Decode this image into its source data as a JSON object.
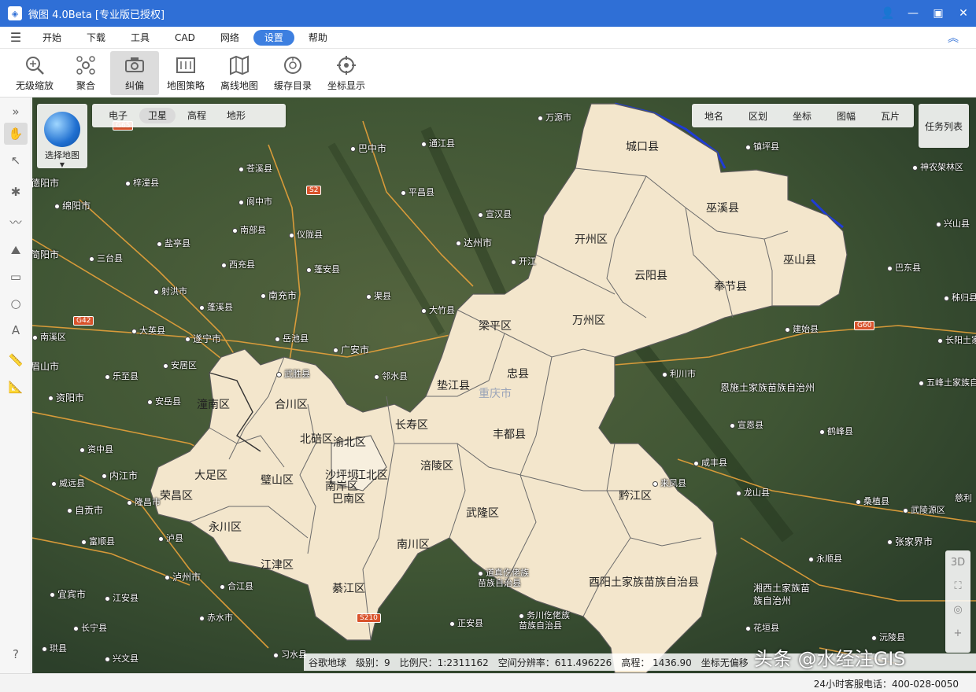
{
  "window": {
    "title": "微图 4.0Beta [专业版已授权]",
    "app_icon": "map-app-icon"
  },
  "menu": {
    "items": [
      "开始",
      "下载",
      "工具",
      "CAD",
      "网络",
      "设置",
      "帮助"
    ],
    "active": "设置"
  },
  "toolbar": {
    "tools": [
      {
        "label": "无级缩放",
        "icon": "zoom-icon"
      },
      {
        "label": "聚合",
        "icon": "cluster-icon"
      },
      {
        "label": "纠偏",
        "icon": "camera-icon"
      },
      {
        "label": "地图策略",
        "icon": "strategy-icon"
      },
      {
        "label": "离线地图",
        "icon": "offline-map-icon"
      },
      {
        "label": "缓存目录",
        "icon": "cache-icon"
      },
      {
        "label": "坐标显示",
        "icon": "target-icon"
      }
    ],
    "active": "纠偏"
  },
  "map_select": {
    "label": "选择地图"
  },
  "map_types": {
    "items": [
      "电子",
      "卫星",
      "高程",
      "地形"
    ],
    "active": "卫星"
  },
  "layers": {
    "items": [
      "地名",
      "区划",
      "坐标",
      "图幅",
      "瓦片"
    ]
  },
  "task_list": {
    "label": "任务列表"
  },
  "right_tools": [
    "3D"
  ],
  "districts": [
    "城口县",
    "巫溪县",
    "开州区",
    "云阳县",
    "巫山县",
    "奉节县",
    "梁平区",
    "万州区",
    "忠县",
    "垫江县",
    "重庆市",
    "潼南区",
    "合川区",
    "长寿区",
    "北碚区",
    "渝北区",
    "丰都县",
    "大足区",
    "璧山区",
    "沙坪坝",
    "江北区",
    "南岸区",
    "涪陵区",
    "荣昌区",
    "巴南区",
    "黔江区",
    "永川区",
    "武隆区",
    "南川区",
    "江津区",
    "綦江区",
    "酉阳土家族苗族自治县"
  ],
  "places": [
    "万源市",
    "巴中市",
    "通江县",
    "镇坪县",
    "神农架林区",
    "苍溪县",
    "梓潼县",
    "绵阳市",
    "阆中市",
    "平昌县",
    "宣汉县",
    "兴山县",
    "达州市",
    "南部县",
    "仪陇县",
    "盐亭县",
    "三台县",
    "开江",
    "巴东县",
    "西充县",
    "蓬安县",
    "射洪市",
    "南充市",
    "渠县",
    "大竹县",
    "秭归县",
    "蓬溪县",
    "大英县",
    "岳池县",
    "遂宁市",
    "广安市",
    "建始县",
    "长阳土家族自治县",
    "安居区",
    "武胜县",
    "邻水县",
    "利川市",
    "乐至县",
    "恩施土家族苗族自治州",
    "五峰土家族自治县",
    "资阳市",
    "安岳县",
    "宣恩县",
    "鹤峰县",
    "资中县",
    "咸丰县",
    "威远县",
    "内江市",
    "来凤县",
    "龙山县",
    "桑植县",
    "慈利",
    "自贡市",
    "隆昌市",
    "武陵源区",
    "富顺县",
    "泸县",
    "张家界市",
    "永顺县",
    "泸州市",
    "合江县",
    "道真仡佬族苗族自治县",
    "湘西土家族苗族自治州",
    "宜宾市",
    "江安县",
    "赤水市",
    "务川仡佬族苗族自治县",
    "花垣县",
    "长宁县",
    "正安县",
    "沅陵县",
    "珙县",
    "兴文县",
    "习水县",
    "德阳市",
    "简阳市",
    "眉山市",
    "南溪区"
  ],
  "roads": [
    "G65",
    "S2",
    "G42",
    "G60",
    "S210"
  ],
  "status": {
    "source": "谷歌地球",
    "level": "级别：9",
    "scale": "比例尺：1:2311162",
    "resolution": "空间分辨率：611.496226",
    "elevation": "高程：  1436.90",
    "correction": "坐标无偏移"
  },
  "watermark": "头条 @水经注GIS",
  "hotline": "24小时客服电话：400-028-0050",
  "colors": {
    "titlebar": "#2f6fd6",
    "menu_active": "#3d7fe0",
    "district_fill": "#f3e6cc",
    "boundary": "#1f3bd6"
  }
}
